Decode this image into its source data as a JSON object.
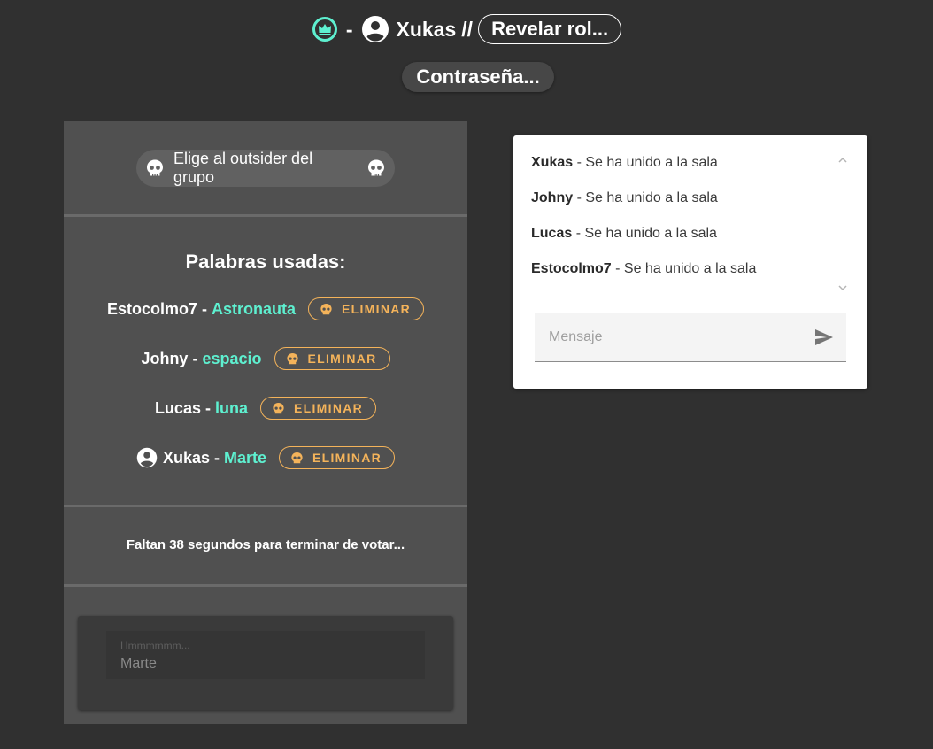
{
  "header": {
    "separator": "-",
    "username": "Xukas",
    "slashes": "//",
    "reveal_role_label": "Revelar rol...",
    "password_label": "Contraseña..."
  },
  "game": {
    "instruction": "Elige al outsider del grupo",
    "words_title": "Palabras usadas:",
    "words": [
      {
        "player": "Estocolmo7",
        "word": "Astronauta",
        "action": "ELIMINAR",
        "is_self": false
      },
      {
        "player": "Johny",
        "word": "espacio",
        "action": "ELIMINAR",
        "is_self": false
      },
      {
        "player": "Lucas",
        "word": "luna",
        "action": "ELIMINAR",
        "is_self": false
      },
      {
        "player": "Xukas",
        "word": "Marte",
        "action": "ELIMINAR",
        "is_self": true
      }
    ],
    "dash": "-",
    "timer": "Faltan 38 segundos para terminar de votar...",
    "guess_label": "Hmmmmmm...",
    "guess_value": "Marte"
  },
  "chat": {
    "messages": [
      {
        "user": "Xukas",
        "text": " - Se ha unido a la sala"
      },
      {
        "user": "Johny",
        "text": " - Se ha unido a la sala"
      },
      {
        "user": "Lucas",
        "text": " - Se ha unido a la sala"
      },
      {
        "user": "Estocolmo7",
        "text": " - Se ha unido a la sala"
      }
    ],
    "placeholder": "Mensaje"
  },
  "colors": {
    "background": "#303030",
    "panel": "#505050",
    "accent_teal": "#5ef0d0",
    "eliminate_orange": "#f4b35a"
  },
  "icons": [
    "crown-icon",
    "account-circle-icon",
    "skull-icon",
    "send-icon",
    "chevron-up-icon",
    "chevron-down-icon"
  ]
}
